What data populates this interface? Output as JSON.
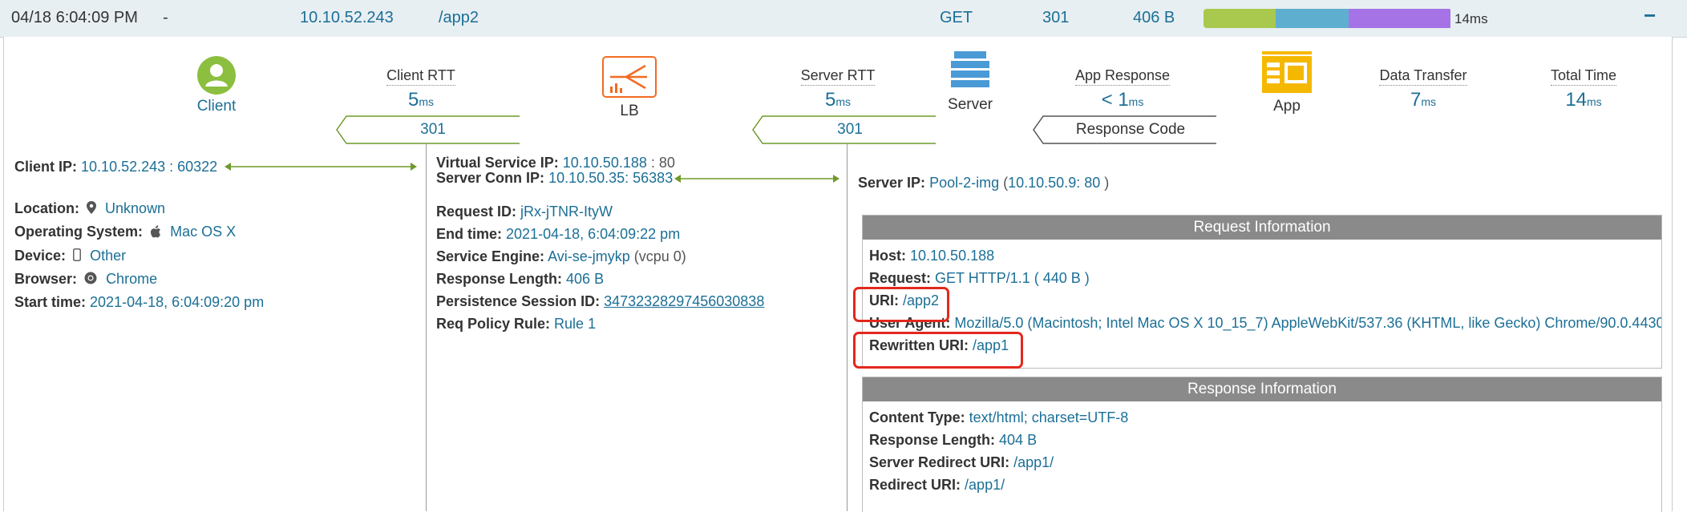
{
  "header": {
    "time": "04/18 6:04:09 PM",
    "dash": "-",
    "client_ip": "10.10.52.243",
    "uri": "/app2",
    "method": "GET",
    "status": "301",
    "size": "406 B",
    "total": "14ms",
    "collapse": "−"
  },
  "timeline": {
    "segments": [
      {
        "name": "client",
        "color": "#a8c94d",
        "fraction": 0.22
      },
      {
        "name": "server",
        "color": "#5eaed0",
        "fraction": 0.22
      },
      {
        "name": "app",
        "color": "#a573e6",
        "fraction": 0.3
      }
    ]
  },
  "flow": {
    "client_label": "Client",
    "lb_label": "LB",
    "server_label": "Server",
    "app_label": "App",
    "client_rtt_label": "Client RTT",
    "client_rtt_value": "5",
    "server_rtt_label": "Server RTT",
    "server_rtt_value": "5",
    "app_response_label": "App Response",
    "app_response_value": "< 1",
    "data_transfer_label": "Data Transfer",
    "data_transfer_value": "7",
    "total_time_label": "Total Time",
    "total_time_value": "14",
    "unit": "ms",
    "code1": "301",
    "code2": "301",
    "code3": "Response Code"
  },
  "client": {
    "ip_label": "Client IP:",
    "ip_value": "10.10.52.243 : 60322",
    "location_label": "Location:",
    "location_value": "Unknown",
    "os_label": "Operating System:",
    "os_value": "Mac OS X",
    "device_label": "Device:",
    "device_value": "Other",
    "browser_label": "Browser:",
    "browser_value": "Chrome",
    "start_label": "Start time:",
    "start_value": "2021-04-18, 6:04:09:20 pm"
  },
  "lb": {
    "vs_ip_label": "Virtual Service IP:",
    "vs_ip_value": "10.10.50.188",
    "vs_port": ": 80",
    "conn_ip_label": "Server Conn IP:",
    "conn_ip_value": "10.10.50.35: 56383",
    "request_id_label": "Request ID:",
    "request_id_value": "jRx-jTNR-ItyW",
    "end_label": "End time:",
    "end_value": "2021-04-18, 6:04:09:22 pm",
    "se_label": "Service Engine:",
    "se_value": "Avi-se-jmykp",
    "se_vcpu": "(vcpu 0)",
    "resp_len_label": "Response Length:",
    "resp_len_value": "406 B",
    "persist_label": "Persistence Session ID:",
    "persist_value": "3473232829745603083​8",
    "policy_label": "Req Policy Rule:",
    "policy_value": "Rule 1"
  },
  "server": {
    "ip_label": "Server IP:",
    "pool": "Pool-2-img",
    "ip_paren_open": "(",
    "ip_value": "10.10.50.9: 80",
    "ip_paren_close": ")"
  },
  "request_info": {
    "title": "Request Information",
    "host_label": "Host:",
    "host_value": "10.10.50.188",
    "request_label": "Request:",
    "request_value": "GET HTTP/1.1 ( 440 B )",
    "uri_label": "URI:",
    "uri_value": "/app2",
    "ua_label": "User Agent:",
    "ua_value": "Mozilla/5.0 (Macintosh; Intel Mac OS X 10_15_7) AppleWebKit/537.36 (KHTML, like Gecko) Chrome/90.0.4430",
    "rewritten_label": "Rewritten URI:",
    "rewritten_value": "/app1"
  },
  "response_info": {
    "title": "Response Information",
    "ct_label": "Content Type:",
    "ct_value": "text/html; charset=UTF-8",
    "len_label": "Response Length:",
    "len_value": "404 B",
    "sr_label": "Server Redirect URI:",
    "sr_value": "/app1/",
    "redirect_label": "Redirect URI:",
    "redirect_value": "/app1/"
  }
}
